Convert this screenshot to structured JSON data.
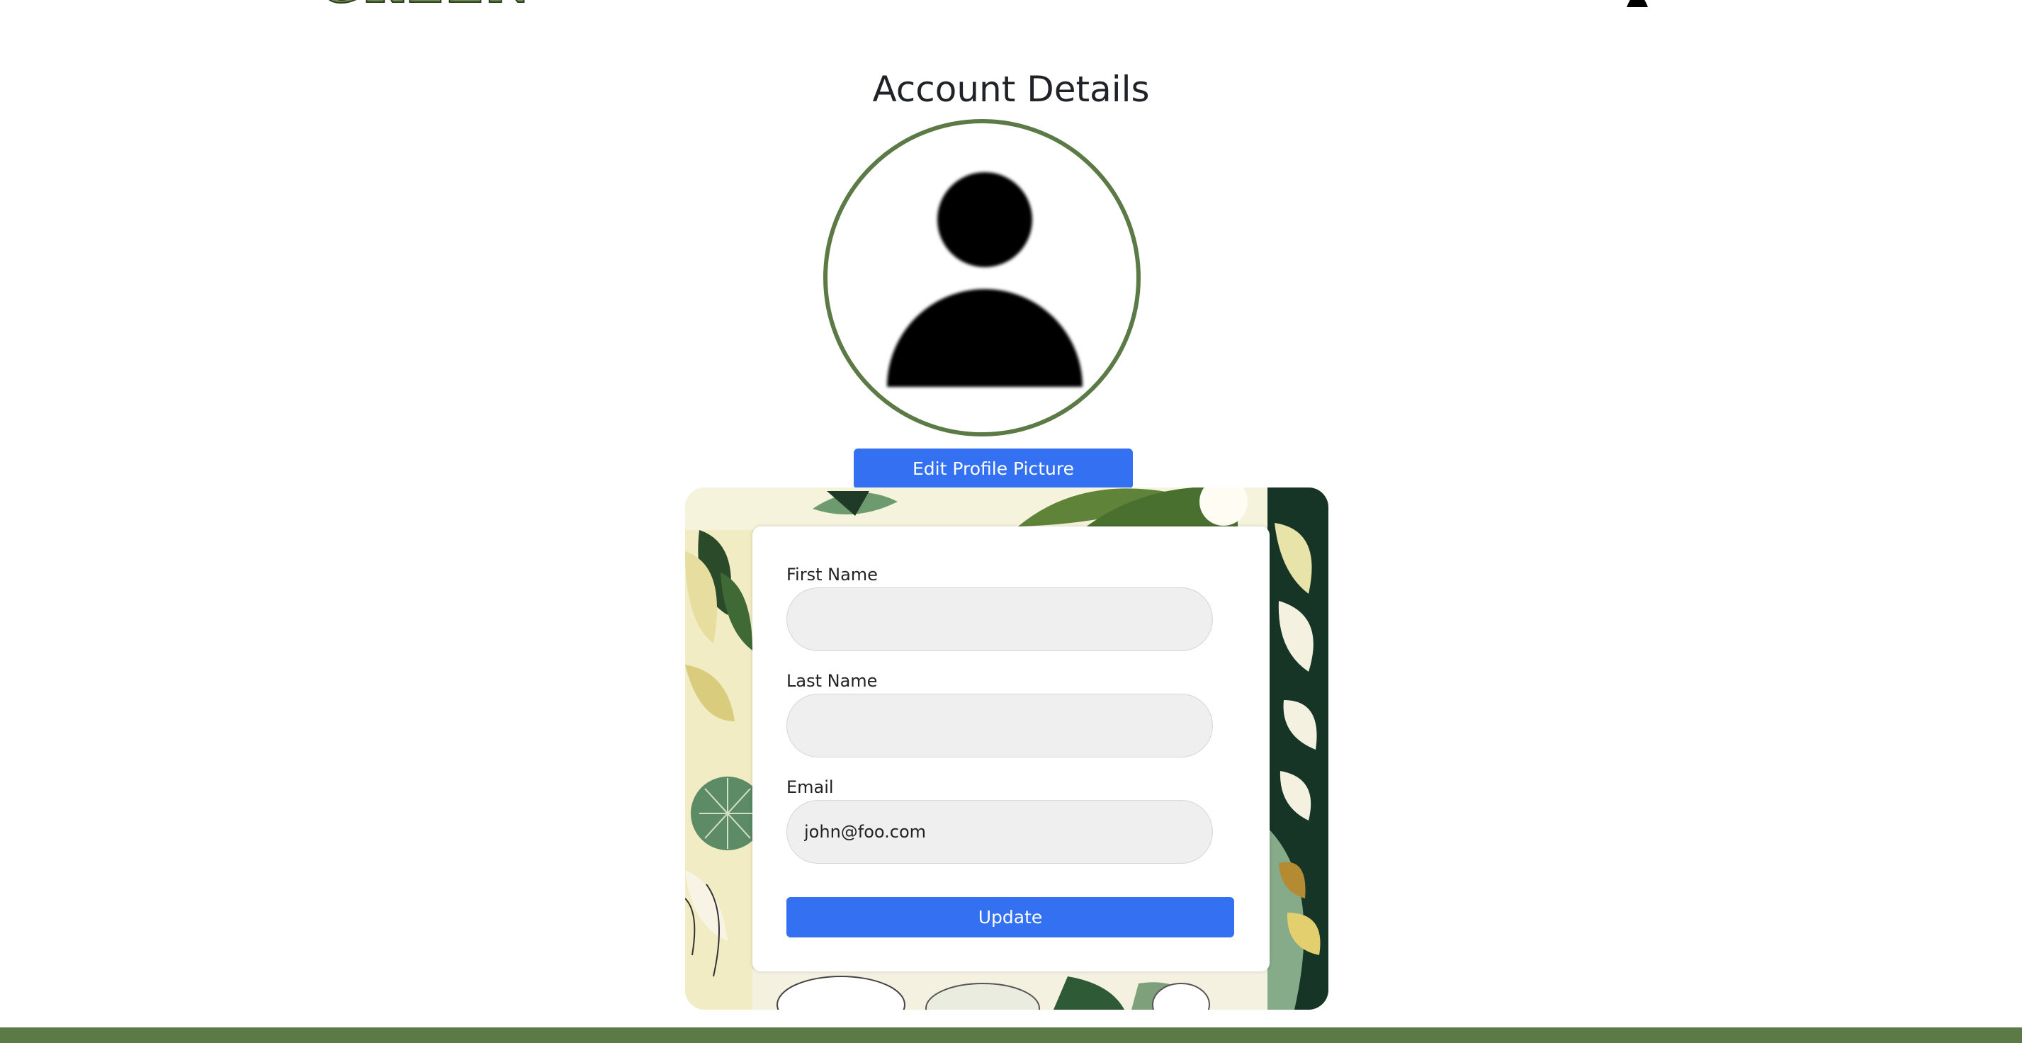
{
  "header": {
    "logo_text": "GREEN",
    "profile_icon": "person-icon"
  },
  "page": {
    "title": "Account Details"
  },
  "avatar": {
    "icon": "default-user-avatar-icon",
    "border_color": "#5b7a45"
  },
  "buttons": {
    "edit_profile_picture": "Edit Profile Picture",
    "update": "Update"
  },
  "form": {
    "first_name": {
      "label": "First Name",
      "value": "",
      "placeholder": ""
    },
    "last_name": {
      "label": "Last Name",
      "value": "",
      "placeholder": ""
    },
    "email": {
      "label": "Email",
      "value": "john@foo.com",
      "placeholder": ""
    }
  },
  "colors": {
    "accent": "#3370f2",
    "brand_green": "#5b7a45",
    "input_bg": "#efefef"
  }
}
